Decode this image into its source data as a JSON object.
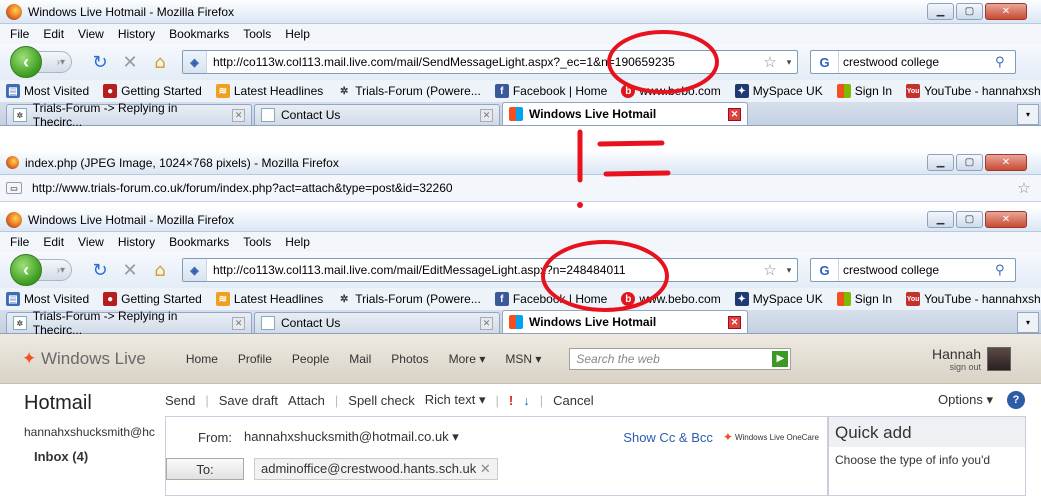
{
  "windows": [
    {
      "title": "Windows Live Hotmail - Mozilla Firefox",
      "menu": [
        "File",
        "Edit",
        "View",
        "History",
        "Bookmarks",
        "Tools",
        "Help"
      ],
      "url": "http://co113w.col113.mail.live.com/mail/SendMessageLight.aspx?_ec=1&n=190659235",
      "search": "crestwood college",
      "tabs": [
        "Trials-Forum -> Replying in Thecirc...",
        "Contact Us",
        "Windows Live Hotmail"
      ]
    },
    {
      "title": "index.php (JPEG Image, 1024×768 pixels) - Mozilla Firefox",
      "url": "http://www.trials-forum.co.uk/forum/index.php?act=attach&type=post&id=32260"
    },
    {
      "title": "Windows Live Hotmail - Mozilla Firefox",
      "menu": [
        "File",
        "Edit",
        "View",
        "History",
        "Bookmarks",
        "Tools",
        "Help"
      ],
      "url": "http://co113w.col113.mail.live.com/mail/EditMessageLight.aspx?n=248484011",
      "search": "crestwood college",
      "tabs": [
        "Trials-Forum -> Replying in Thecirc...",
        "Contact Us",
        "Windows Live Hotmail"
      ]
    }
  ],
  "bookmarks": [
    "Most Visited",
    "Getting Started",
    "Latest Headlines",
    "Trials-Forum (Powere...",
    "Facebook | Home",
    "www.bebo.com",
    "MySpace UK",
    "Sign In",
    "YouTube - hannahxsh..."
  ],
  "hotmail": {
    "brand": "Windows Live",
    "nav": [
      "Home",
      "Profile",
      "People",
      "Mail",
      "Photos",
      "More ▾",
      "MSN ▾"
    ],
    "search_placeholder": "Search the web",
    "user": "Hannah",
    "sign_out": "sign out",
    "title": "Hotmail",
    "account": "hannahxshucksmith@hc",
    "inbox": "Inbox (4)",
    "toolbar": [
      "Send",
      "Save draft",
      "Attach",
      "Spell check",
      "Rich text ▾",
      "!",
      "↓",
      "Cancel"
    ],
    "options": "Options ▾",
    "from_label": "From:",
    "from_value": "hannahxshucksmith@hotmail.co.uk ▾",
    "show_cc": "Show Cc & Bcc",
    "onecare": "Windows Live OneCare",
    "to_label": "To:",
    "to_value": "adminoffice@crestwood.hants.sch.uk",
    "quick_add_title": "Quick add",
    "quick_add_text": "Choose the type of info you'd"
  },
  "colors": {
    "annotation_red": "#e8121e",
    "wl_green": "#3b9a24"
  }
}
